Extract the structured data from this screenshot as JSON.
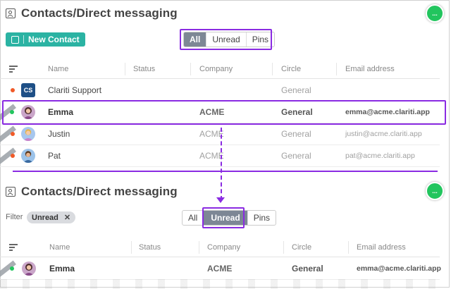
{
  "top": {
    "title": "Contacts/Direct messaging",
    "new_contact_label": "New Contact",
    "chat_icon": "...",
    "tabs": [
      {
        "label": "All",
        "active": true
      },
      {
        "label": "Unread",
        "active": false
      },
      {
        "label": "Pins",
        "active": false
      }
    ],
    "columns": [
      "Name",
      "Status",
      "Company",
      "Circle",
      "Email address"
    ],
    "rows": [
      {
        "avatar": "CS",
        "name": "Clariti Support",
        "status": "",
        "company": "",
        "circle": "General",
        "email": "",
        "status_color": "#f05a28",
        "pinned": false,
        "bold": false
      },
      {
        "avatar": "",
        "name": "Emma",
        "status": "",
        "company": "ACME",
        "circle": "General",
        "email": "emma@acme.clariti.app",
        "status_color": "#22c55e",
        "pinned": true,
        "bold": true
      },
      {
        "avatar": "",
        "name": "Justin",
        "status": "",
        "company": "ACME",
        "circle": "General",
        "email": "justin@acme.clariti.app",
        "status_color": "#f05a28",
        "pinned": true,
        "bold": false
      },
      {
        "avatar": "",
        "name": "Pat",
        "status": "",
        "company": "ACME",
        "circle": "General",
        "email": "pat@acme.clariti.app",
        "status_color": "#f05a28",
        "pinned": true,
        "bold": false
      }
    ]
  },
  "bottom": {
    "title": "Contacts/Direct messaging",
    "chat_icon": "...",
    "filter_label": "Filter",
    "filter_chip": "Unread",
    "filter_chip_close": "✕",
    "tabs": [
      {
        "label": "All",
        "active": false
      },
      {
        "label": "Unread",
        "active": true
      },
      {
        "label": "Pins",
        "active": false
      }
    ],
    "columns": [
      "Name",
      "Status",
      "Company",
      "Circle",
      "Email address"
    ],
    "rows": [
      {
        "avatar": "",
        "name": "Emma",
        "status": "",
        "company": "ACME",
        "circle": "General",
        "email": "emma@acme.clariti.app",
        "status_color": "#22c55e",
        "pinned": true,
        "bold": true
      }
    ]
  },
  "colors": {
    "accent": "#2bb3a3",
    "highlight": "#8a2be2",
    "online": "#22c55e",
    "away": "#f05a28",
    "tab_active": "#7d8795"
  },
  "icons": [
    "contacts-icon",
    "chat-bubble-icon",
    "sort-icon",
    "close-icon",
    "pin-ribbon-icon"
  ]
}
